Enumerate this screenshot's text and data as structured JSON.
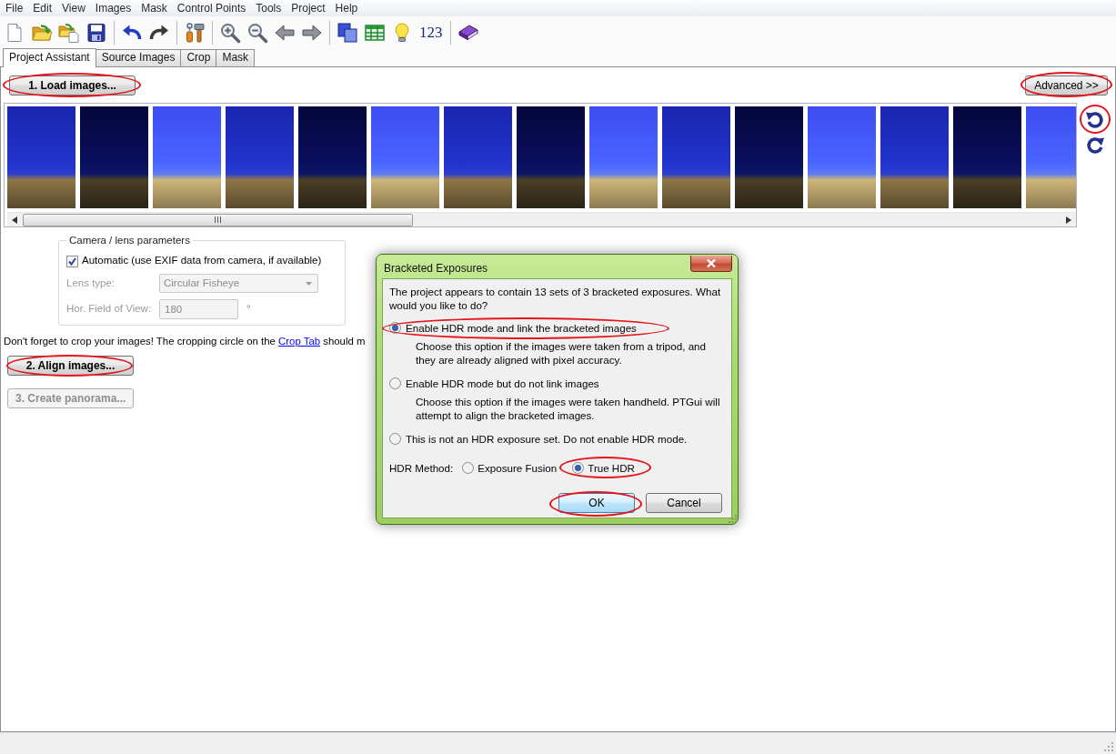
{
  "menu": [
    {
      "label": "File"
    },
    {
      "label": "Edit"
    },
    {
      "label": "View"
    },
    {
      "label": "Images"
    },
    {
      "label": "Mask"
    },
    {
      "label": "Control Points"
    },
    {
      "label": "Tools"
    },
    {
      "label": "Project"
    },
    {
      "label": "Help"
    }
  ],
  "toolbar": {
    "numbers_label": "123"
  },
  "tabs": [
    {
      "label": "Project Assistant",
      "selected": true
    },
    {
      "label": "Source Images",
      "selected": false
    },
    {
      "label": "Crop",
      "selected": false
    },
    {
      "label": "Mask",
      "selected": false
    }
  ],
  "load_button": {
    "label": "1. Load images...",
    "highlighted": true
  },
  "advanced_button": {
    "label": "Advanced >>",
    "highlighted": true
  },
  "thumbnails": [
    {
      "kind": "medium"
    },
    {
      "kind": "dark"
    },
    {
      "kind": "bright"
    },
    {
      "kind": "medium"
    },
    {
      "kind": "dark"
    },
    {
      "kind": "bright"
    },
    {
      "kind": "medium"
    },
    {
      "kind": "dark"
    },
    {
      "kind": "bright"
    },
    {
      "kind": "medium"
    },
    {
      "kind": "dark"
    },
    {
      "kind": "bright"
    },
    {
      "kind": "medium"
    },
    {
      "kind": "dark"
    },
    {
      "kind": "bright"
    }
  ],
  "rotate_buttons": [
    {
      "kind": "counterclockwise",
      "highlighted": true
    },
    {
      "kind": "clockwise",
      "highlighted": false
    }
  ],
  "camera_lens": {
    "title": "Camera / lens parameters",
    "automatic": {
      "label": "Automatic (use EXIF data from camera, if available)",
      "checked": true
    },
    "fields": [
      {
        "kind": "dropdown",
        "label": "Lens type:",
        "value": "Circular Fisheye",
        "disabled": true
      },
      {
        "kind": "number",
        "label": "Hor. Field of View:",
        "value": "180",
        "unit": "°",
        "disabled": true
      }
    ]
  },
  "crop_hint": {
    "text_before": "Don't forget to crop your images! The cropping circle on the",
    "link": "Crop Tab",
    "text_after": "should m"
  },
  "steps": [
    {
      "label": "2. Align images...",
      "disabled": false,
      "highlighted": true
    },
    {
      "label": "3. Create panorama...",
      "disabled": true,
      "highlighted": false
    }
  ],
  "dialog": {
    "title": "Bracketed Exposures",
    "message": "The project appears to contain 13 sets of 3 bracketed exposures. What would you like to do?",
    "options": [
      {
        "label": "Enable HDR mode and link the bracketed images",
        "description": "Choose this option if the images were taken from a tripod, and they are already aligned with pixel accuracy.",
        "selected": true,
        "highlighted": true
      },
      {
        "label": "Enable HDR mode but do not link images",
        "description": "Choose this option if the images were taken handheld. PTGui will attempt to align the bracketed images.",
        "selected": false,
        "highlighted": false
      },
      {
        "label": "This is not an HDR exposure set. Do not enable HDR mode.",
        "selected": false,
        "highlighted": false
      }
    ],
    "hdr_method": {
      "label": "HDR Method:",
      "options": [
        {
          "label": "Exposure Fusion",
          "selected": false,
          "highlighted": false
        },
        {
          "label": "True HDR",
          "selected": true,
          "highlighted": true
        }
      ]
    },
    "buttons": [
      {
        "label": "OK",
        "default": true,
        "highlighted": true
      },
      {
        "label": "Cancel",
        "default": false,
        "highlighted": false
      }
    ]
  }
}
